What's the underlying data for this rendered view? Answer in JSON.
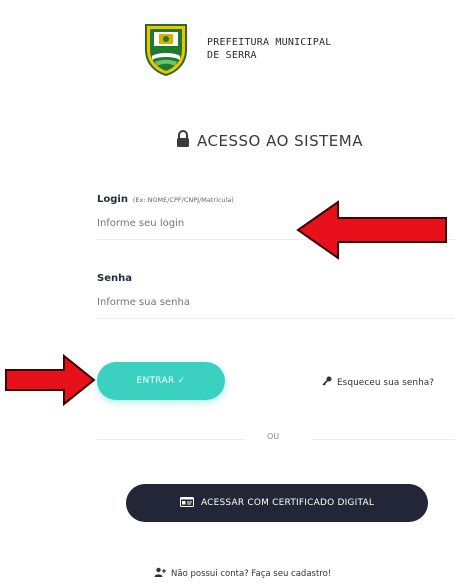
{
  "header": {
    "org_line1": "PREFEITURA MUNICIPAL",
    "org_line2": "DE SERRA",
    "crest_icon": "city-crest-icon"
  },
  "title": {
    "text": "ACESSO AO SISTEMA",
    "icon": "lock-icon"
  },
  "login_field": {
    "label": "Login",
    "hint": "(Ex: NOME/CPF/CNPJ/Matricula)",
    "placeholder": "Informe seu login",
    "value": ""
  },
  "password_field": {
    "label": "Senha",
    "placeholder": "Informe sua senha",
    "value": ""
  },
  "actions": {
    "enter_label": "ENTRAR ✓",
    "forgot_label": "Esqueceu sua senha?",
    "forgot_icon": "key-icon",
    "divider_label": "OU",
    "certificate_label": "ACESSAR COM CERTIFICADO DIGITAL",
    "certificate_icon": "id-card-icon",
    "register_label": "Não possui conta? Faça seu cadastro!",
    "register_icon": "add-user-icon"
  },
  "colors": {
    "accent": "#3bd1c0",
    "dark_button": "#222636",
    "annotation_arrow": "#e8101a"
  }
}
